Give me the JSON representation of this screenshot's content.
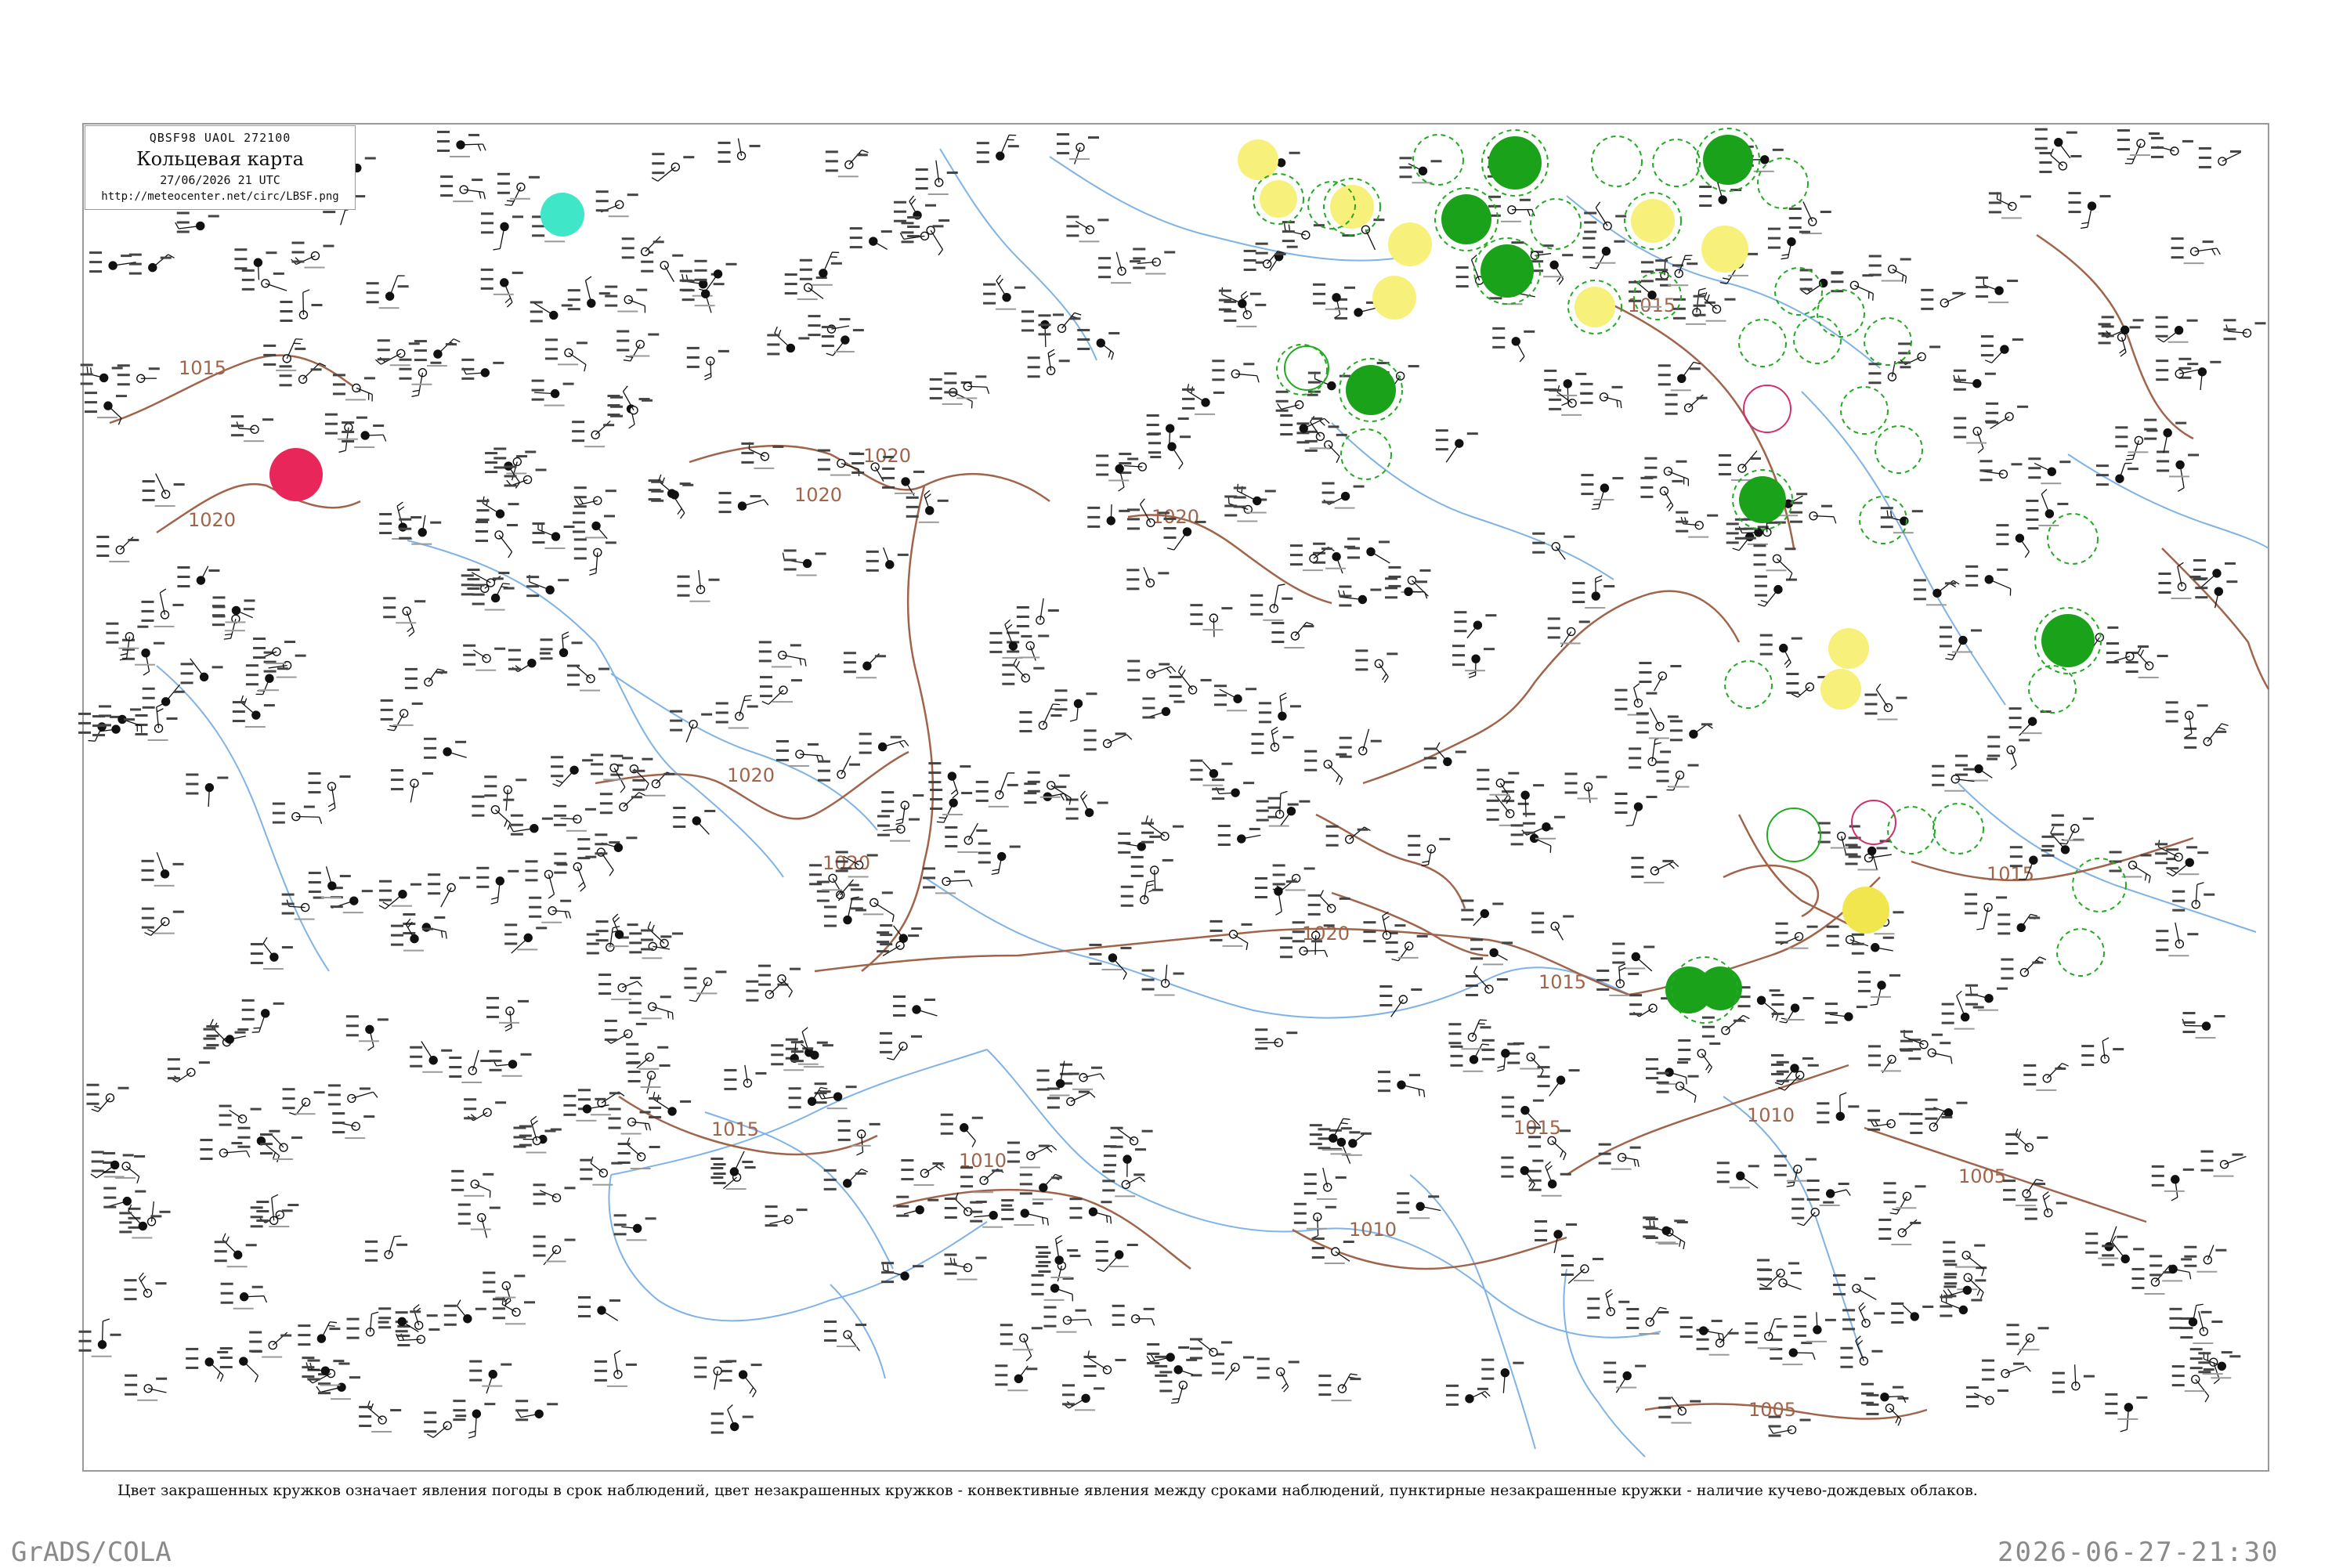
{
  "header": {
    "code": "QBSF98  UAOL  272100",
    "title": "Кольцевая карта",
    "datetime": "27/06/2026 21 UTC",
    "url": "http://meteocenter.net/circ/LBSF.png"
  },
  "legend": {
    "text": "Цвет закрашенных кружков означает явления погоды в срок наблюдений, цвет незакрашенных кружков - конвективные явления между сроками наблюдений, пунктирные незакрашенные кружки - наличие кучево-дождевых облаков."
  },
  "footer": {
    "left": "GrADS/COLA",
    "right": "2026-06-27-21:30"
  },
  "isobars": [
    "1015",
    "1020",
    "1020",
    "1020",
    "1020",
    "1020",
    "1020",
    "1020",
    "1015",
    "1015",
    "1010",
    "1015",
    "1010",
    "1015",
    "1010",
    "1005",
    "1015",
    "1005"
  ],
  "colors": {
    "isobar": "#a0644a",
    "water": "#7fb3e6",
    "frame": "#9a9a9a",
    "rain": "#1aa31a",
    "thunder": "#f7f07a",
    "fog": "#f2e64f",
    "snow": "#3fe6c8",
    "hazard": "#e8265a",
    "cb_dashed": "#22aa22",
    "convective": "#d0306e"
  }
}
